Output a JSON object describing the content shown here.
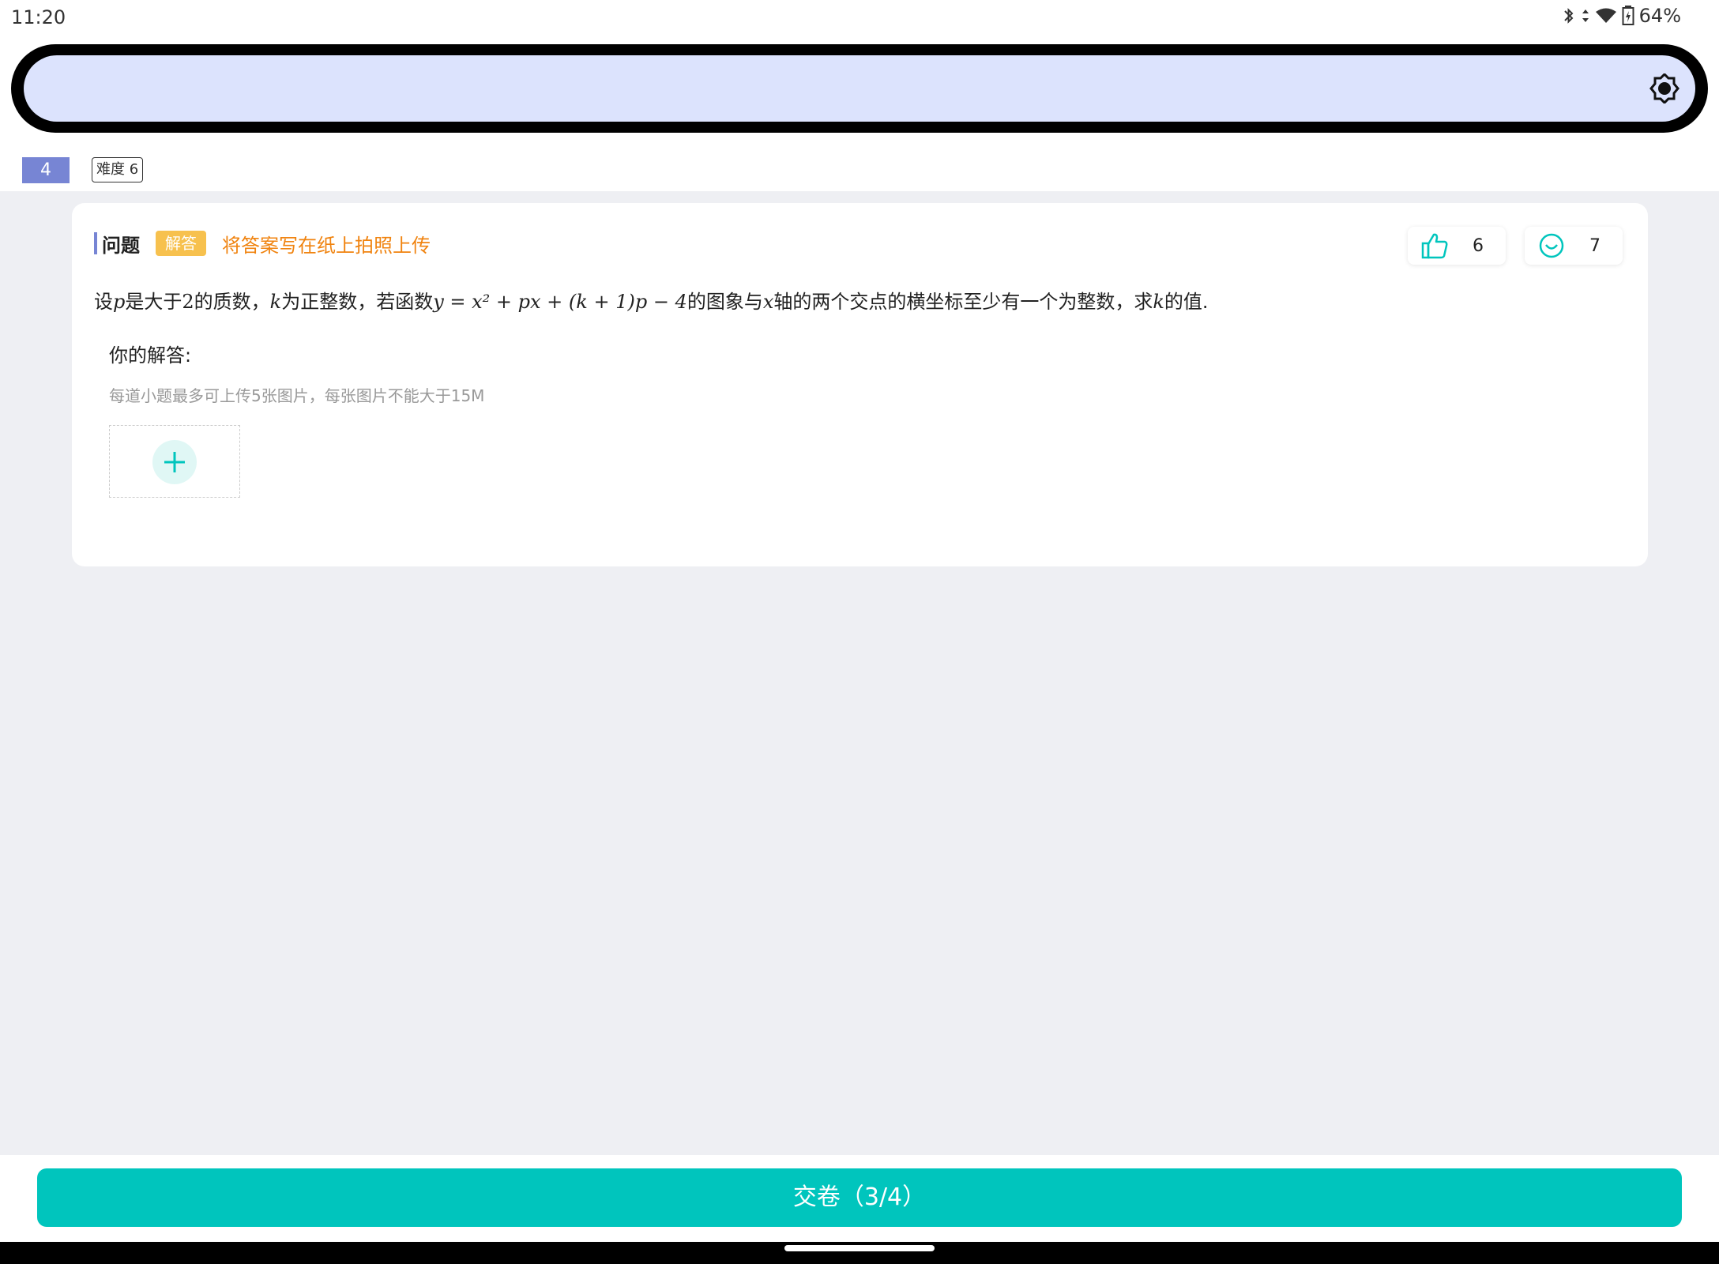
{
  "status_bar": {
    "time": "11:20",
    "battery": "64%",
    "icons": [
      "bluetooth-icon",
      "data-arrows-icon",
      "wifi-icon",
      "battery-icon"
    ]
  },
  "toolbar": {
    "search_value": "",
    "right_icon": "brightness-icon"
  },
  "question_meta": {
    "number": "4",
    "difficulty": "难度 6"
  },
  "question": {
    "section_title": "问题",
    "type_badge": "解答",
    "instruction": "将答案写在纸上拍照上传",
    "likes": "6",
    "smiles": "7",
    "text_parts": {
      "t1": "设",
      "m1": "p",
      "t2": "是大于",
      "n1": "2",
      "t3": "的质数，",
      "m2": "k",
      "t4": "为正整数，若函数",
      "formula": "y = x² + px + (k + 1)p − 4",
      "t5": "的图象与",
      "m3": "x",
      "t6": "轴的两个交点的横坐标至少有一个为整数，求",
      "m4": "k",
      "t7": "的值."
    }
  },
  "answer": {
    "label": "你的解答:",
    "hint": "每道小题最多可上传5张图片，每张图片不能大于15M"
  },
  "footer": {
    "submit_label": "交卷（3/4）"
  },
  "colors": {
    "accent": "#00c5bd",
    "number_badge": "#7785d4",
    "type_badge": "#f7c14e",
    "instruction": "#f0830f",
    "search_bg": "#dce3fd"
  }
}
